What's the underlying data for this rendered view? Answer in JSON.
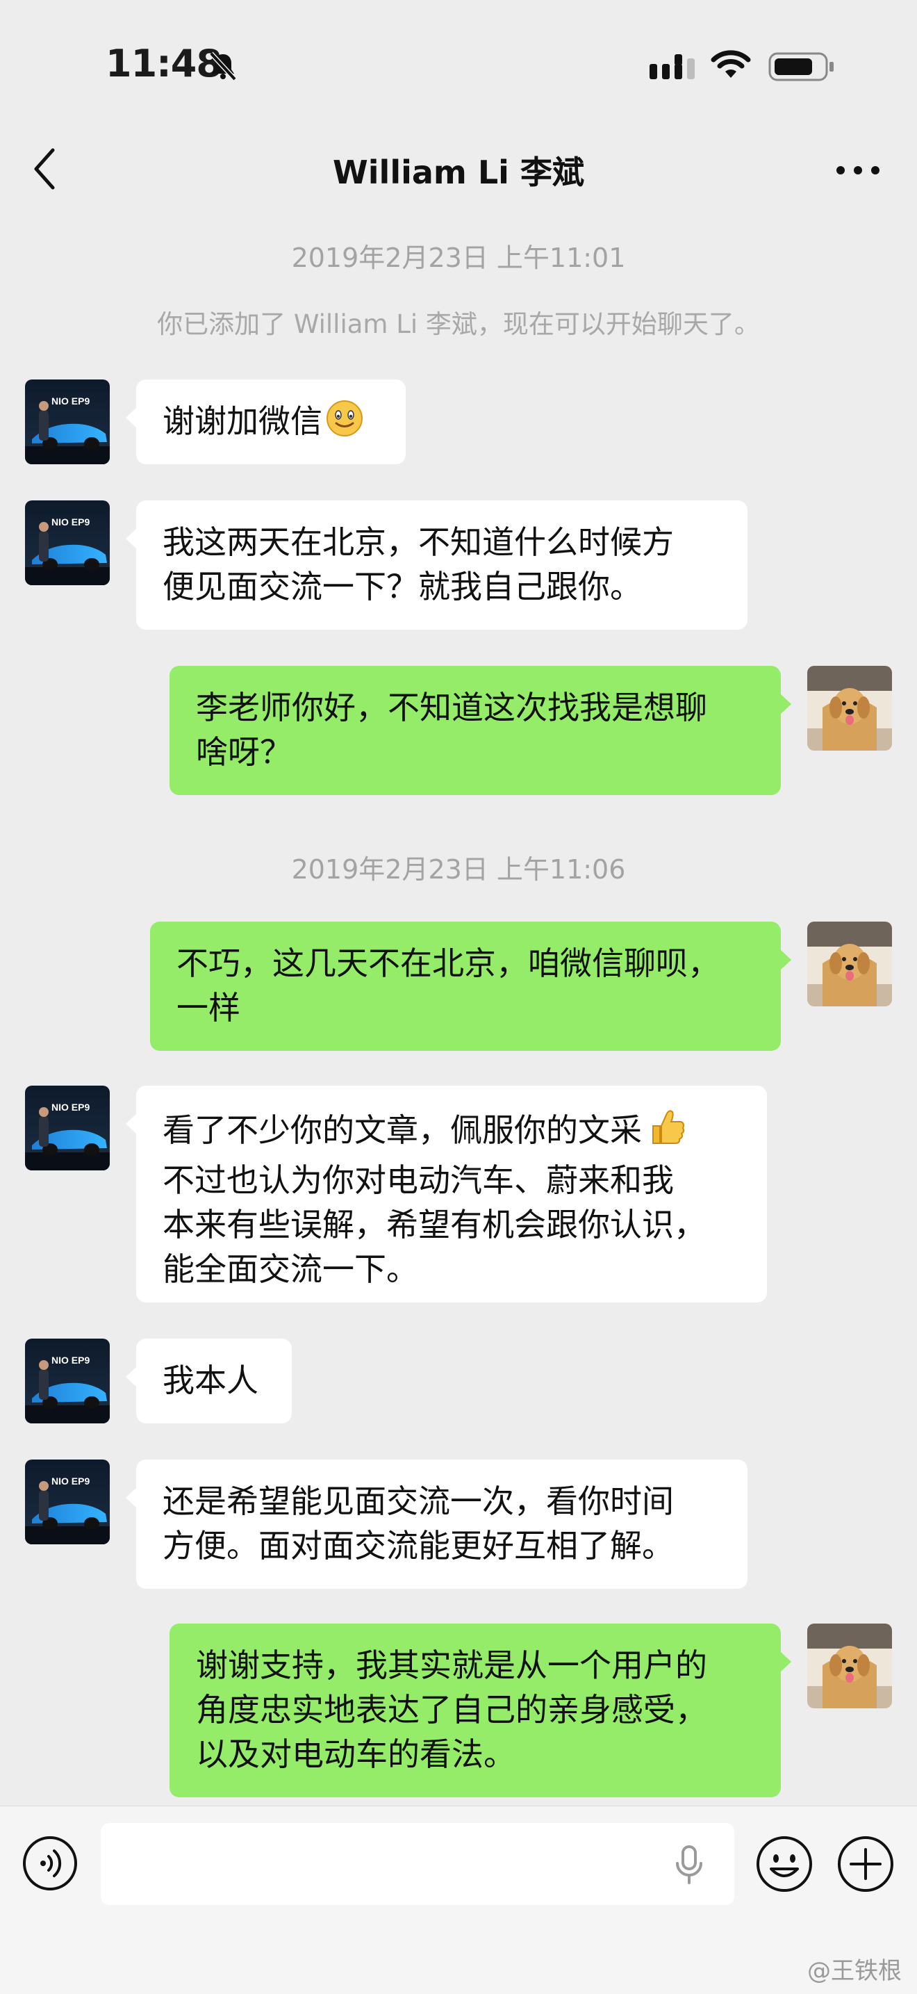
{
  "status_bar": {
    "time": "11:48",
    "silent_icon": "bell-slash-icon",
    "signal_icon": "signal-icon",
    "wifi_icon": "wifi-icon",
    "battery_icon": "battery-icon"
  },
  "nav": {
    "title": "William Li 李斌",
    "back_icon": "chevron-left-icon",
    "more_icon": "more-icon"
  },
  "chat": {
    "timestamp_1": "2019年2月23日 上午11:01",
    "added_notice": "你已添加了 William Li 李斌，现在可以开始聊天了。",
    "timestamp_2": "2019年2月23日 上午11:06",
    "messages": [
      {
        "from": "William Li",
        "lines": [
          "谢谢加微信"
        ],
        "emoji": "smile-emoji-icon"
      },
      {
        "from": "William Li",
        "lines": [
          "我这两天在北京，不知道什么时候方",
          "便见面交流一下？就我自己跟你。"
        ]
      },
      {
        "from": "me",
        "lines": [
          "李老师你好，不知道这次找我是想聊",
          "啥呀？"
        ]
      },
      {
        "from": "me",
        "lines": [
          "不巧，这几天不在北京，咱微信聊呗，",
          "一样"
        ]
      },
      {
        "from": "William Li",
        "lines": [
          "看了不少你的文章，佩服你的文采",
          "不过也认为你对电动汽车、蔚来和我",
          "本来有些误解，希望有机会跟你认识，",
          "能全面交流一下。"
        ],
        "emoji": "thumbs-up-emoji-icon"
      },
      {
        "from": "William Li",
        "lines": [
          "我本人"
        ]
      },
      {
        "from": "William Li",
        "lines": [
          "还是希望能见面交流一次，看你时间",
          "方便。面对面交流能更好互相了解。"
        ]
      },
      {
        "from": "me",
        "lines": [
          "谢谢支持，我其实就是从一个用户的",
          "角度忠实地表达了自己的亲身感受，",
          "以及对电动车的看法。"
        ]
      }
    ],
    "avatar_brand_text": "NIO EP9"
  },
  "input_bar": {
    "voice_icon": "voice-input-icon",
    "mic_icon": "microphone-icon",
    "emoji_icon": "emoji-icon",
    "plus_icon": "plus-icon",
    "text_value": ""
  },
  "watermark": "@王铁根",
  "colors": {
    "background": "#ededed",
    "outgoing_bubble": "#95ec69",
    "incoming_bubble": "#ffffff"
  }
}
